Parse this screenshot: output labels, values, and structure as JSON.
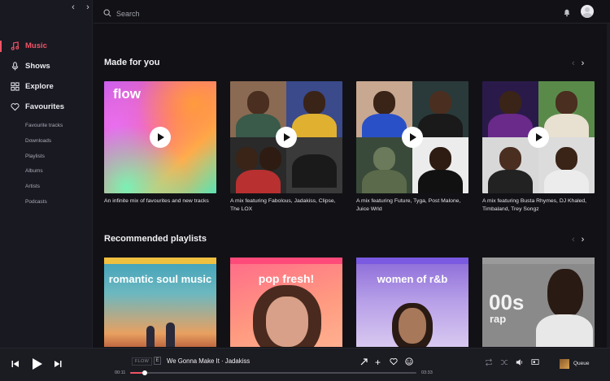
{
  "sidebar": {
    "nav": [
      {
        "label": "Music",
        "icon": "music-note-icon",
        "active": true
      },
      {
        "label": "Shows",
        "icon": "microphone-icon",
        "active": false
      },
      {
        "label": "Explore",
        "icon": "grid-icon",
        "active": false
      },
      {
        "label": "Favourites",
        "icon": "heart-icon",
        "active": false
      }
    ],
    "sub": [
      "Favourite tracks",
      "Downloads",
      "Playlists",
      "Albums",
      "Artists",
      "Podcasts"
    ]
  },
  "header": {
    "search_placeholder": "Search"
  },
  "made_for_you": {
    "title": "Made for you",
    "cards": [
      {
        "caption": "An infinite mix of favourites and new tracks",
        "art_label": "flow"
      },
      {
        "caption": "A mix featuring Fabolous, Jadakiss, Clipse, The LOX"
      },
      {
        "caption": "A mix featuring Future, Tyga, Post Malone, Juice Wrld"
      },
      {
        "caption": "A mix featuring Busta Rhymes, DJ Khaled, Timbaland, Trey Songz"
      }
    ]
  },
  "recommended": {
    "title": "Recommended playlists",
    "cards": [
      {
        "title": "romantic soul music"
      },
      {
        "title": "pop fresh!"
      },
      {
        "title": "women of r&b"
      },
      {
        "title_big": "00s",
        "title_small": "rap"
      }
    ]
  },
  "player": {
    "source": "FLOW",
    "context_badge": "E",
    "track": "We Gonna Make It · Jadakiss",
    "elapsed": "00:11",
    "duration": "03:33",
    "progress": 0.052,
    "queue_label": "Queue"
  },
  "colors": {
    "accent": "#ef5466",
    "background": "#121216",
    "sidebar": "#191922"
  }
}
